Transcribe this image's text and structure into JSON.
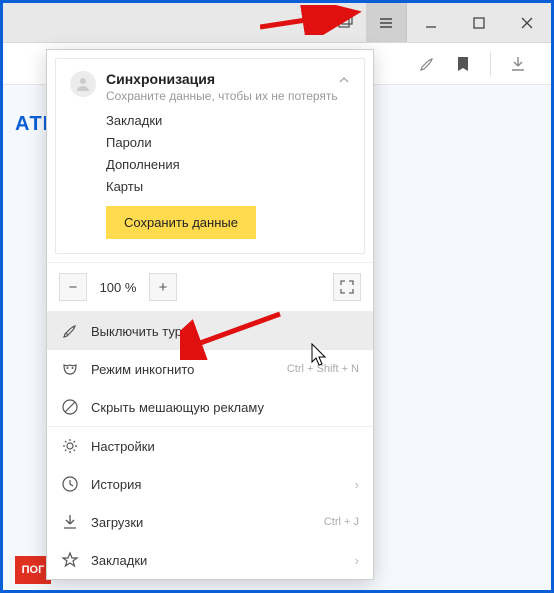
{
  "titlebar": {
    "stack_tt": "Tabs",
    "menu_tt": "Menu",
    "minimize_tt": "Свернуть",
    "maximize_tt": "Развернуть",
    "close_tt": "Закрыть"
  },
  "toolbar": {
    "rocket_tt": "Turbo",
    "bookmark_tt": "Закладки",
    "download_tt": "Загрузки"
  },
  "background": {
    "partial_text": "АТНА",
    "red_box": "ПОГ"
  },
  "sync": {
    "title": "Синхронизация",
    "subtitle": "Сохраните данные, чтобы их не потерять",
    "links": [
      "Закладки",
      "Пароли",
      "Дополнения",
      "Карты"
    ],
    "button": "Сохранить данные"
  },
  "zoom": {
    "minus": "−",
    "value": "100 %",
    "plus": "+",
    "fullscreen_tt": "Полный экран"
  },
  "items": {
    "turbo": {
      "label": "Выключить турбо"
    },
    "incognito": {
      "label": "Режим инкогнито",
      "shortcut": "Ctrl + Shift + N"
    },
    "hide_ads": {
      "label": "Скрыть мешающую рекламу"
    },
    "settings": {
      "label": "Настройки"
    },
    "history": {
      "label": "История"
    },
    "downloads": {
      "label": "Загрузки",
      "shortcut": "Ctrl + J"
    },
    "bookmarks": {
      "label": "Закладки"
    }
  }
}
